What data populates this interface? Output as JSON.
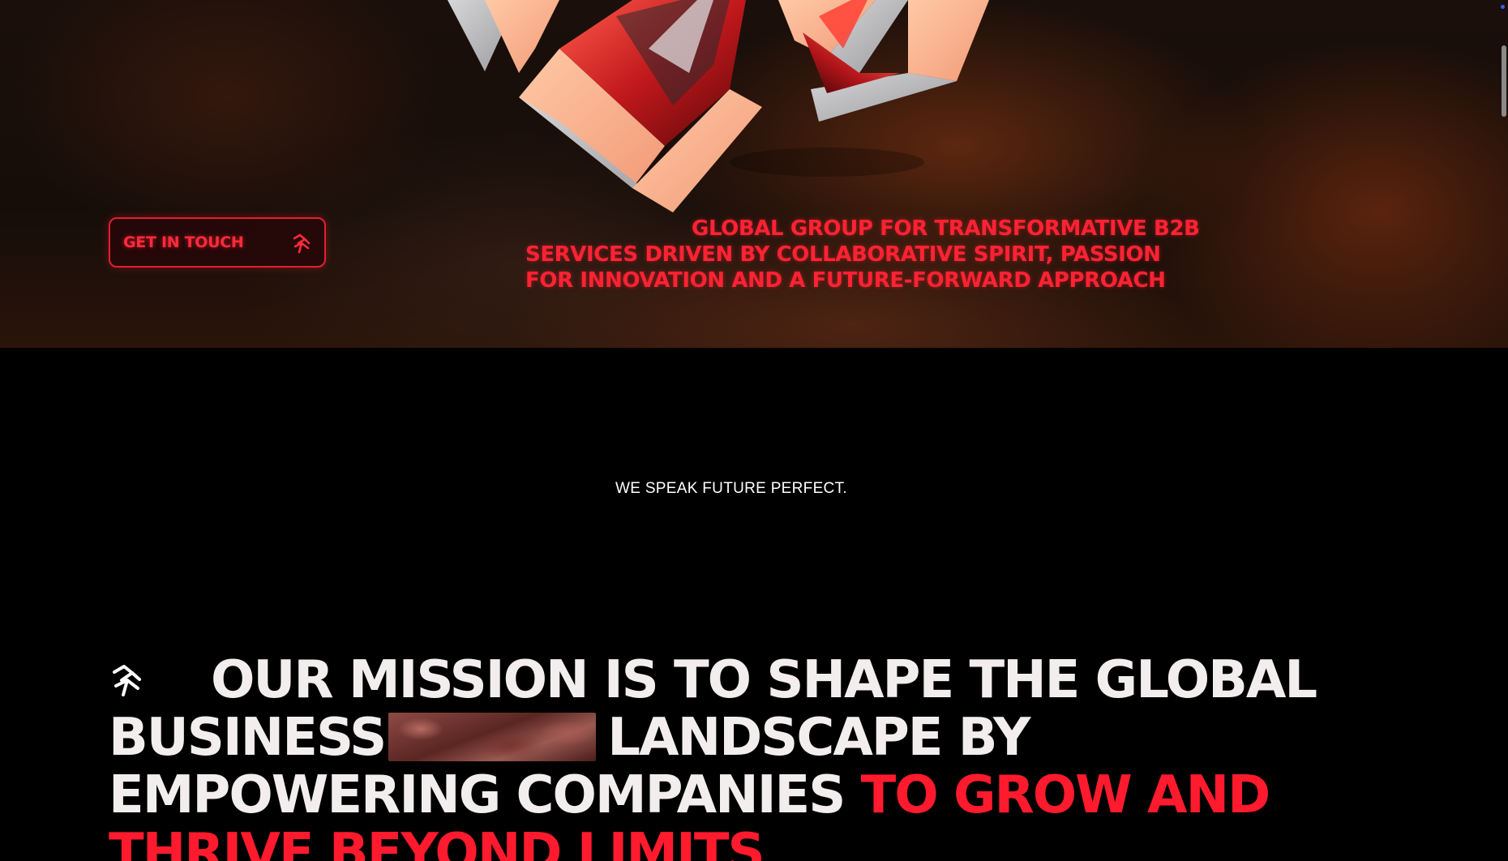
{
  "hero": {
    "cta_label": "GET IN TOUCH",
    "cta_icon": "brand-mark-icon",
    "tagline": "GLOBAL GROUP FOR TRANSFORMATIVE B2B SERVICES DRIVEN BY COLLABORATIVE SPIRIT, PASSION FOR INNOVATION AND A FUTURE-FORWARD APPROACH"
  },
  "intro": {
    "kicker": "WE SPEAK FUTURE PERFECT."
  },
  "mission": {
    "icon": "brand-mark-icon",
    "part1": "OUR MISSION IS TO SHAPE THE GLOBAL BUSINESS",
    "part2": "LANDSCAPE BY EMPOWERING COMPANIES",
    "accent": "TO GROW AND THRIVE BEYOND LIMITS"
  },
  "colors": {
    "accent_red": "#ff1b2d",
    "background": "#000000",
    "text_light": "#f3eeee"
  }
}
